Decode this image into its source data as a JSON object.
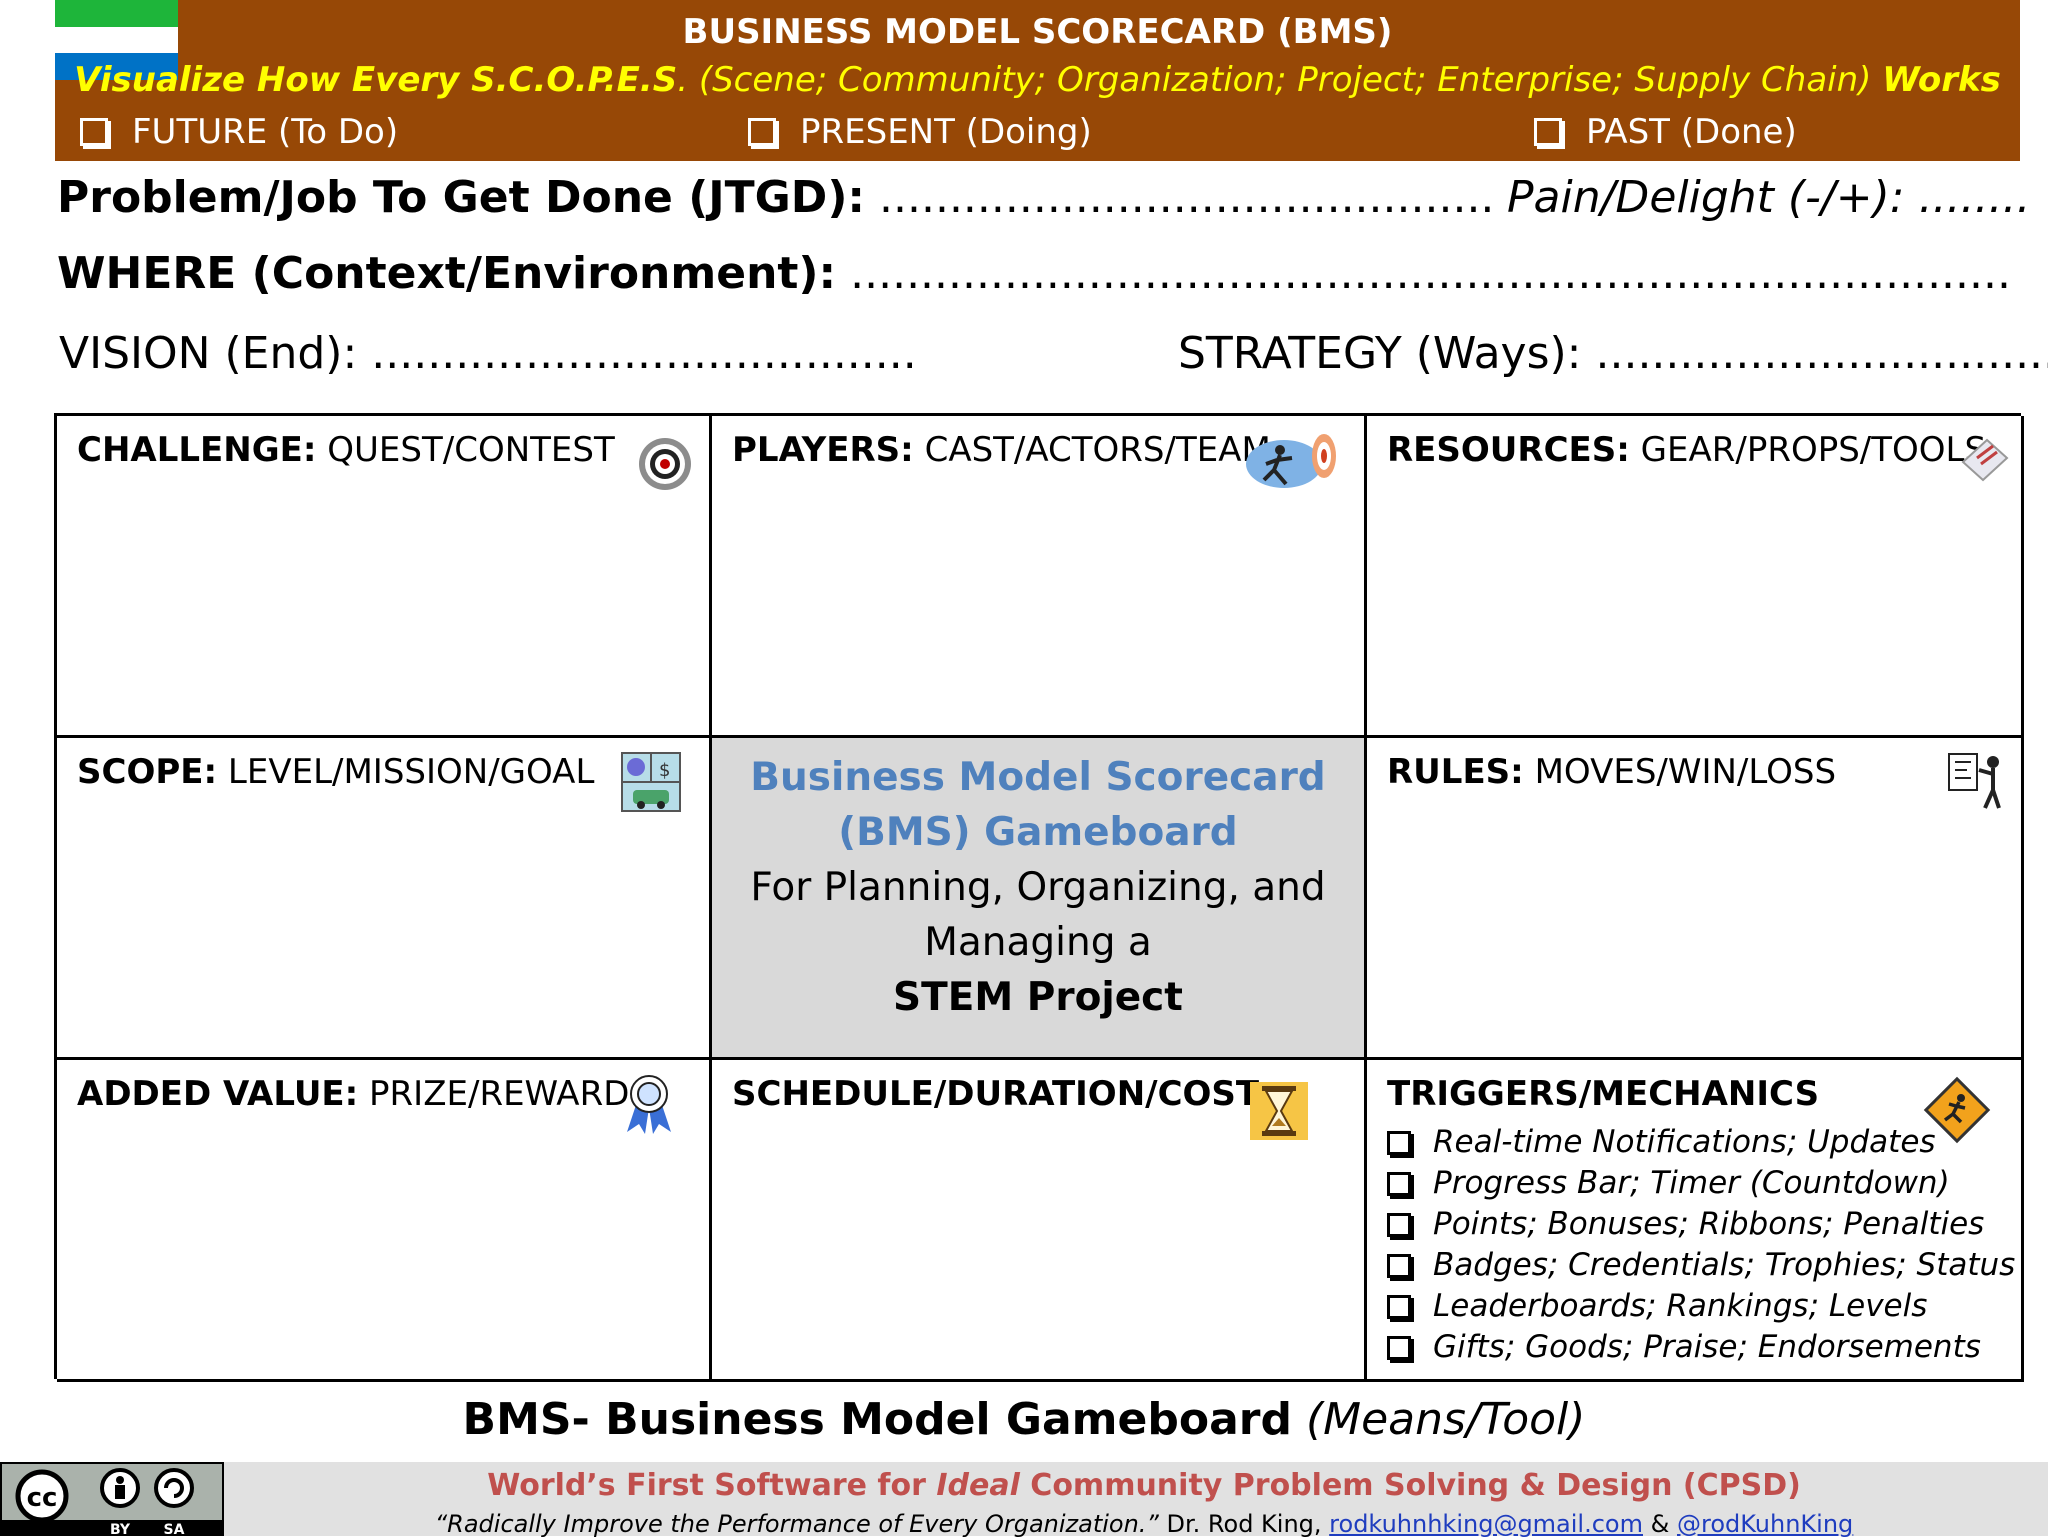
{
  "header": {
    "title": "BUSINESS MODEL SCORECARD (BMS)",
    "subtitle_lead": "Visualize How Every S.C.O.P.E.S",
    "subtitle_mid": ". (Scene; Community; Organization; Project; Enterprise; Supply Chain) ",
    "subtitle_end": "Works",
    "checkboxes": [
      "FUTURE (To Do)",
      "PRESENT (Doing)",
      "PAST (Done)"
    ],
    "colors": {
      "band": "#974806",
      "subtitle": "#ffff00"
    }
  },
  "fields": {
    "problem_label": "Problem/Job To Get Done (JTGD):",
    "problem_dots": " ............................................",
    "pain_label": "Pain/Delight (-/+): ........",
    "where_label": "WHERE (Context/Environment):",
    "where_dots": " ...................................................................................",
    "vision_label": "VISION (End): .......................................",
    "strategy_label": "STRATEGY (Ways): ................................."
  },
  "grid": {
    "challenge": {
      "head": "CHALLENGE:",
      "sub": " QUEST/CONTEST",
      "icon": "target-icon"
    },
    "players": {
      "head": "PLAYERS:",
      "sub": " CAST/ACTORS/TEAM",
      "icon": "runner-target-icon"
    },
    "resources": {
      "head": "RESOURCES:",
      "sub": " GEAR/PROPS/TOOLS",
      "icon": "tools-icon"
    },
    "scope": {
      "head": "SCOPE:",
      "sub": " LEVEL/MISSION/GOAL",
      "icon": "mission-icon"
    },
    "center": {
      "title_line1": "Business Model Scorecard",
      "title_line2": "(BMS) Gameboard",
      "line3": "For Planning, Organizing, and",
      "line4": "Managing a",
      "line5": "STEM Project"
    },
    "rules": {
      "head": "RULES:",
      "sub": " MOVES/WIN/LOSS",
      "icon": "presenter-chart-icon"
    },
    "added_value": {
      "head": "ADDED VALUE:",
      "sub": " PRIZE/REWARD",
      "icon": "ribbon-icon"
    },
    "schedule": {
      "head": "SCHEDULE/DURATION/COST",
      "icon": "hourglass-icon"
    },
    "triggers": {
      "head": "TRIGGERS/MECHANICS",
      "icon": "warning-runner-icon",
      "items": [
        "Real-time Notifications; Updates",
        "Progress Bar; Timer (Countdown)",
        "Points; Bonuses; Ribbons; Penalties",
        "Badges; Credentials; Trophies; Status",
        "Leaderboards; Rankings; Levels",
        "Gifts; Goods; Praise; Endorsements"
      ]
    }
  },
  "caption": {
    "bold": "BMS- Business Model Gameboard",
    "italic": " (Means/Tool)"
  },
  "footer": {
    "cc": {
      "labels": [
        "BY",
        "SA"
      ]
    },
    "title_a": "World’s First Software for ",
    "title_b": "Ideal",
    "title_c": " Community Problem Solving & Design (CPSD)",
    "quote": "“Radically Improve the Performance of Every Organization.”",
    "author": " Dr. Rod King, ",
    "email": "rodkuhnhking@gmail.com",
    "amp": " & ",
    "handle": "@rodKuhnKing"
  }
}
